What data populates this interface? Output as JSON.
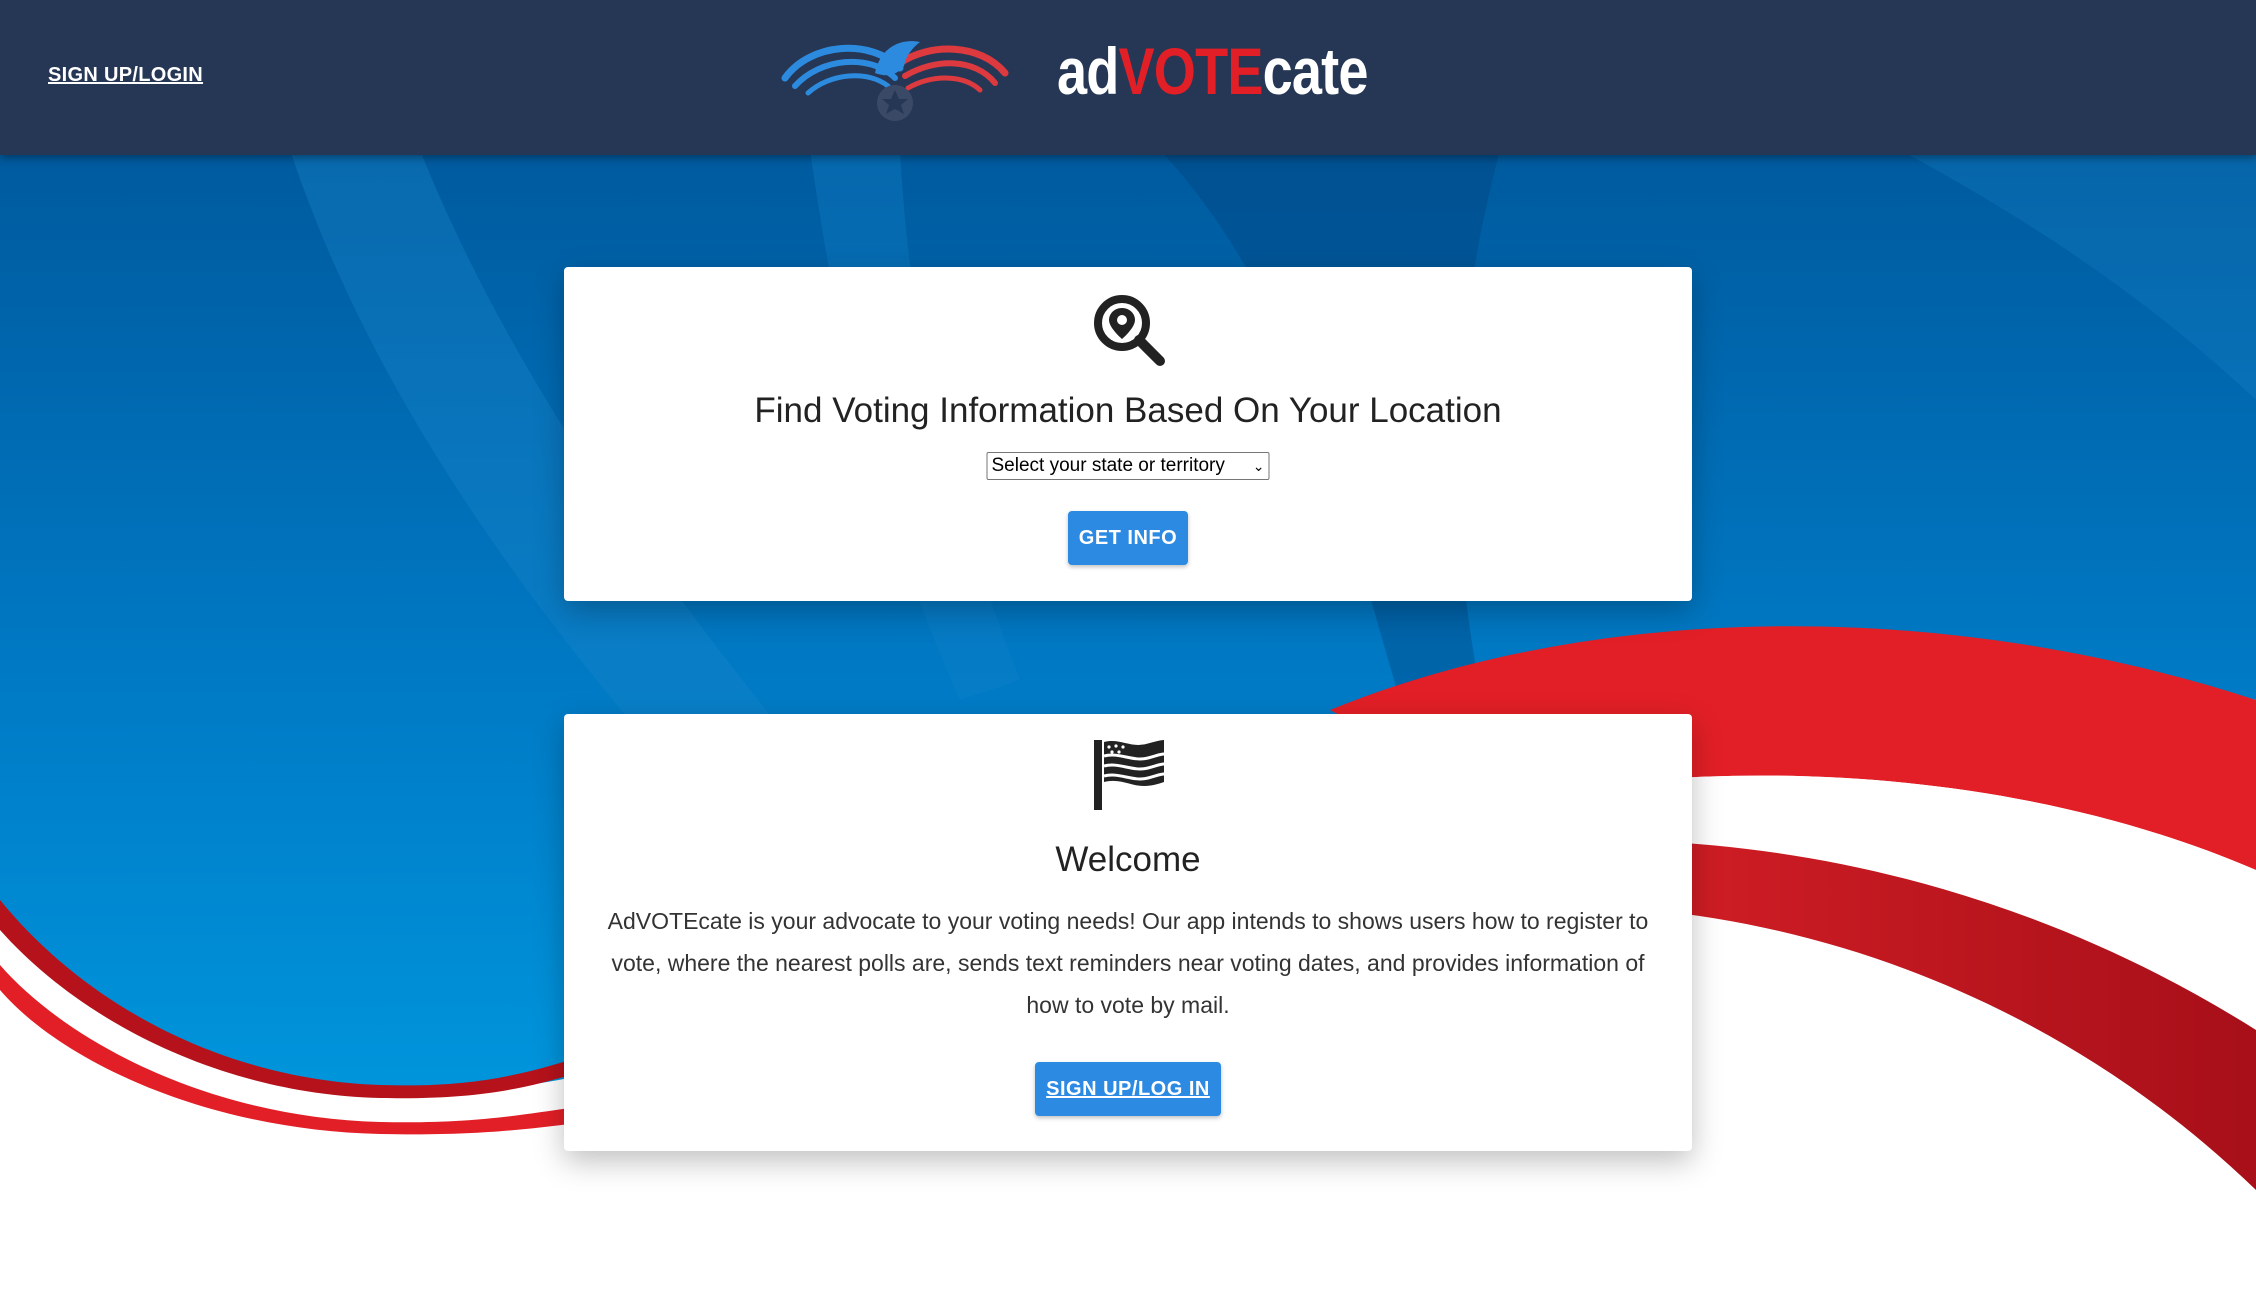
{
  "header": {
    "login_link": "SIGN UP/LOGIN",
    "brand": {
      "part1": "ad",
      "part2": "VOTE",
      "part3": "cate"
    },
    "background_color": "#263755"
  },
  "location_card": {
    "icon": "location-search-icon",
    "title": "Find Voting Information Based On Your Location",
    "select_value": "Select your state or territory",
    "button_label": "GET INFO"
  },
  "welcome_card": {
    "icon": "flag-icon",
    "title": "Welcome",
    "body": "AdVOTEcate is your advocate to your voting needs! Our app intends to shows users how to register to vote, where the nearest polls are, sends text reminders near voting dates, and provides information of how to vote by mail.",
    "button_label": "SIGN UP/LOG IN"
  },
  "colors": {
    "accent_blue": "#2c8ae3",
    "brand_red": "#e21f26",
    "background_blue": "#0077c2"
  }
}
